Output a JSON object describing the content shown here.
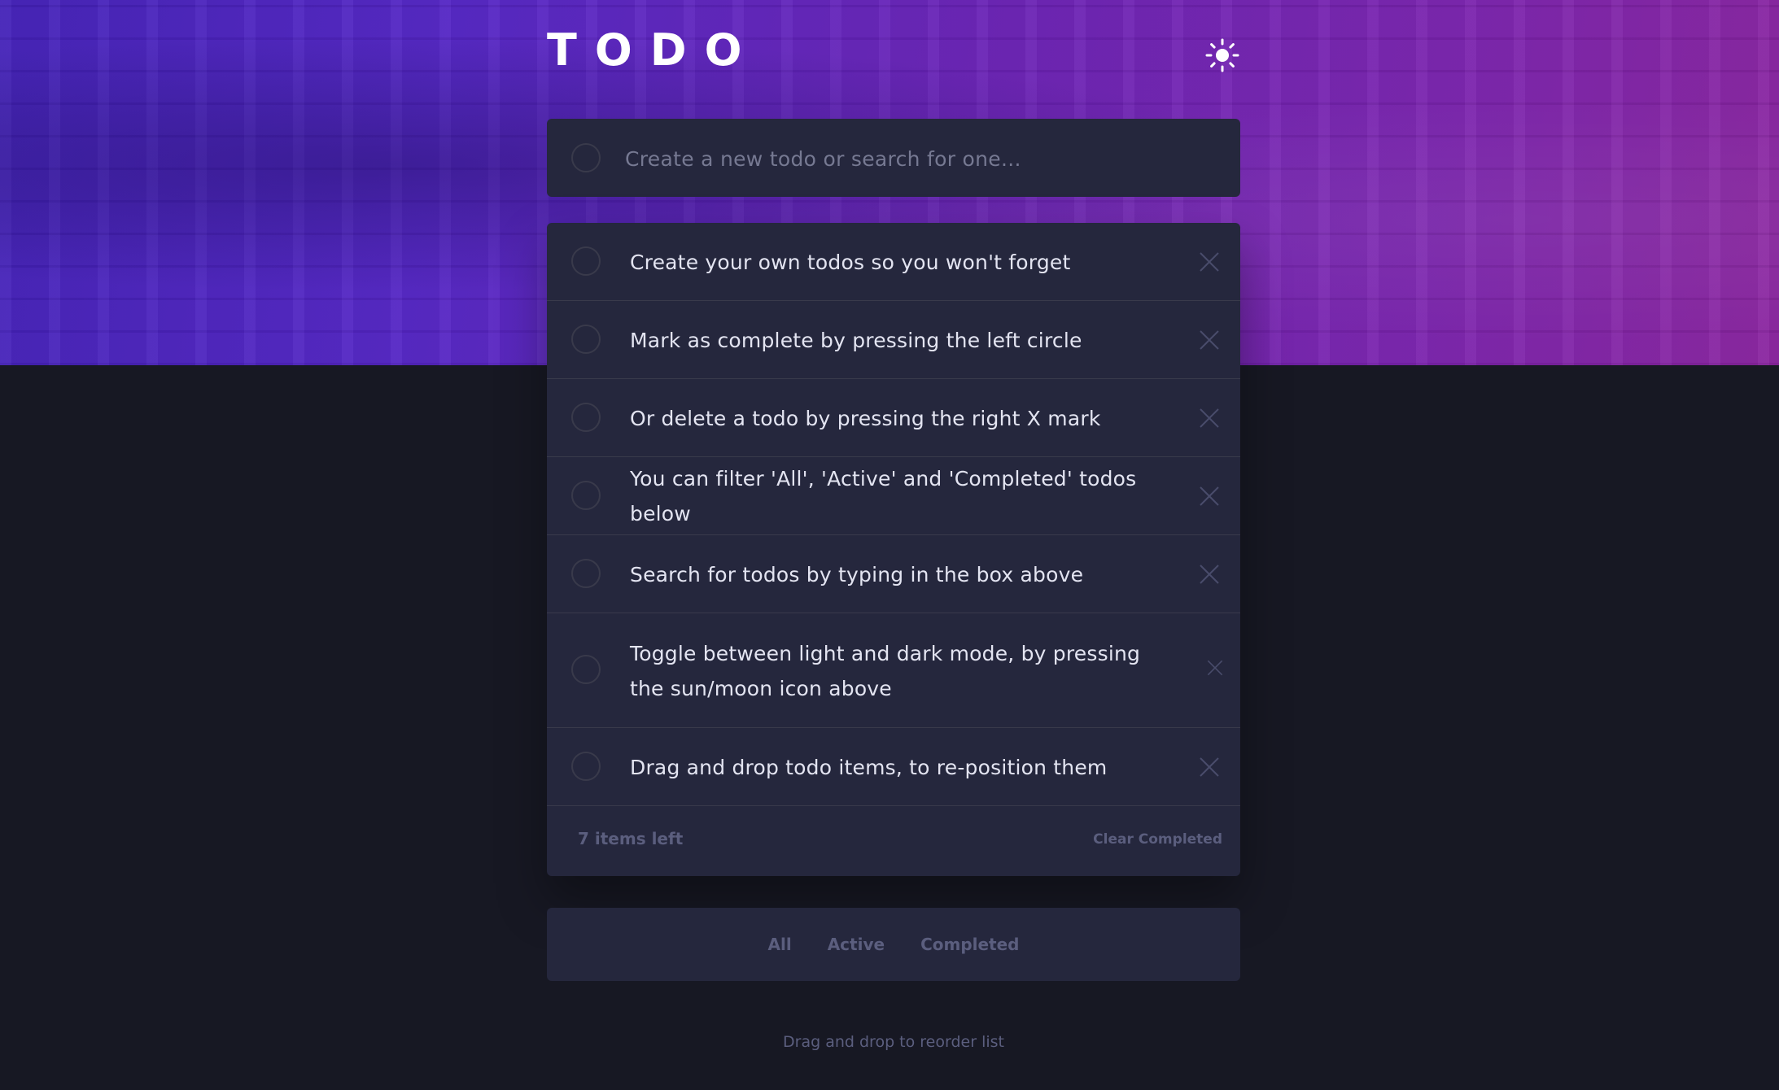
{
  "app": {
    "title": "TODO",
    "theme_icon": "sun-icon"
  },
  "new_todo": {
    "placeholder": "Create a new todo or search for one..."
  },
  "todos": [
    {
      "text": "Create your own todos so you won't forget",
      "completed": false
    },
    {
      "text": "Mark as complete by pressing the left circle",
      "completed": false
    },
    {
      "text": "Or delete a todo by pressing the right X mark",
      "completed": false
    },
    {
      "text": "You can filter 'All', 'Active' and 'Completed' todos below",
      "completed": false
    },
    {
      "text": "Search for todos by typing in the box above",
      "completed": false
    },
    {
      "text": "Toggle between light and dark mode, by pressing the sun/moon icon above",
      "completed": false
    },
    {
      "text": "Drag and drop todo items, to re-position them",
      "completed": false
    }
  ],
  "footer": {
    "items_left": "7 items left",
    "clear_completed": "Clear Completed"
  },
  "filters": {
    "all": "All",
    "active": "Active",
    "completed": "Completed"
  },
  "hint": "Drag and drop to reorder list",
  "colors": {
    "background": "#171823",
    "card": "#25273d",
    "divider": "#393a4b",
    "text": "#e3e4f1",
    "muted": "#5b5e7e",
    "hero_start": "#4321b8",
    "hero_end": "#8a249f"
  }
}
